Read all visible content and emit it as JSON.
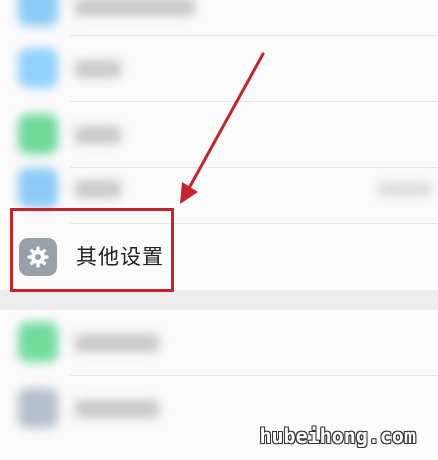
{
  "settings_list": {
    "highlighted_item": {
      "label": "其他设置",
      "icon": "gear-icon",
      "icon_bg": "#9aa0a8"
    }
  },
  "annotation": {
    "box_color": "#c4242b",
    "arrow_color": "#c4242b"
  },
  "watermark": {
    "text": "hubeihong.com"
  }
}
